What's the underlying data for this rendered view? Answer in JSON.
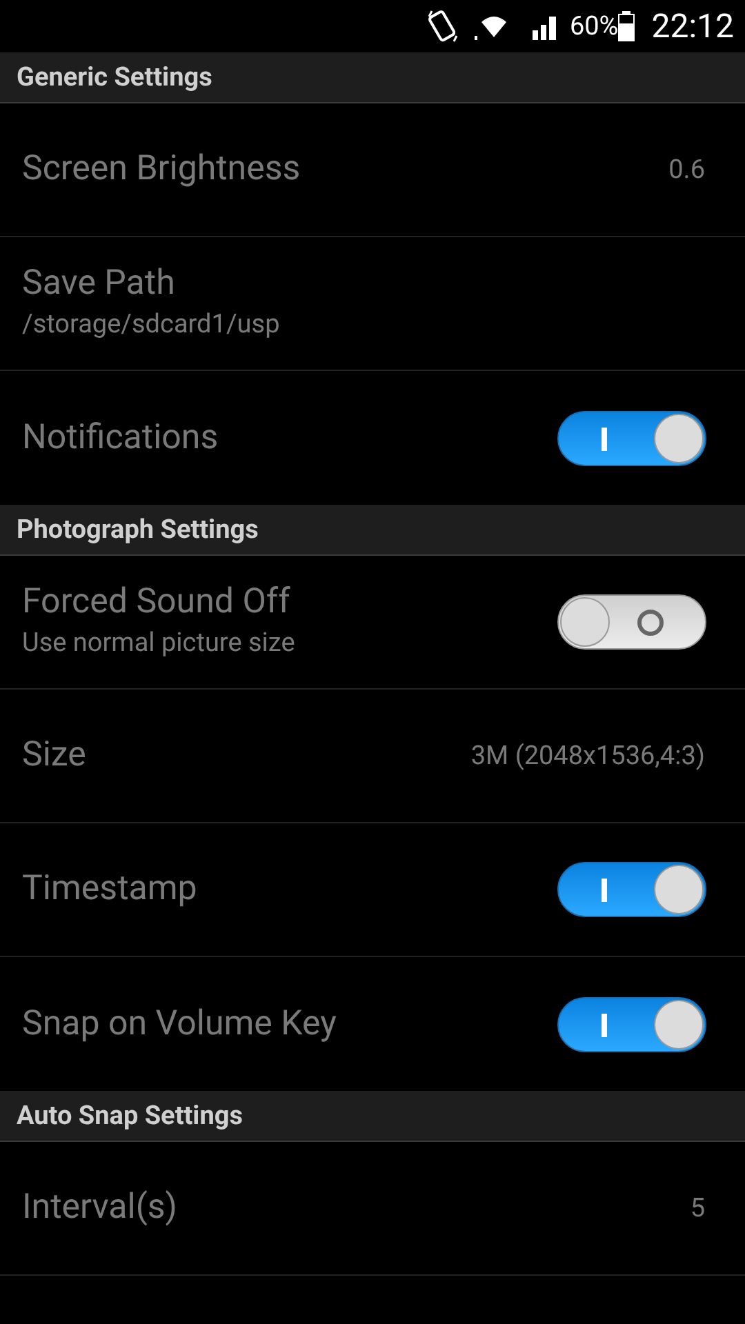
{
  "status_bar": {
    "battery": "60%",
    "time": "22:12"
  },
  "sections": [
    {
      "title": "Generic Settings",
      "items": [
        {
          "kind": "value",
          "title": "Screen Brightness",
          "value": "0.6"
        },
        {
          "kind": "text",
          "title": "Save Path",
          "summary": "/storage/sdcard1/usp"
        },
        {
          "kind": "toggle",
          "title": "Notifications",
          "on": true
        }
      ]
    },
    {
      "title": "Photograph Settings",
      "items": [
        {
          "kind": "toggle",
          "title": "Forced Sound Off",
          "summary": "Use normal picture size",
          "on": false
        },
        {
          "kind": "value",
          "title": "Size",
          "value": "3M (2048x1536,4:3)"
        },
        {
          "kind": "toggle",
          "title": "Timestamp",
          "on": true
        },
        {
          "kind": "toggle",
          "title": "Snap on Volume Key",
          "on": true
        }
      ]
    },
    {
      "title": "Auto Snap Settings",
      "items": [
        {
          "kind": "value",
          "title": "Interval(s)",
          "value": "5"
        }
      ]
    }
  ]
}
